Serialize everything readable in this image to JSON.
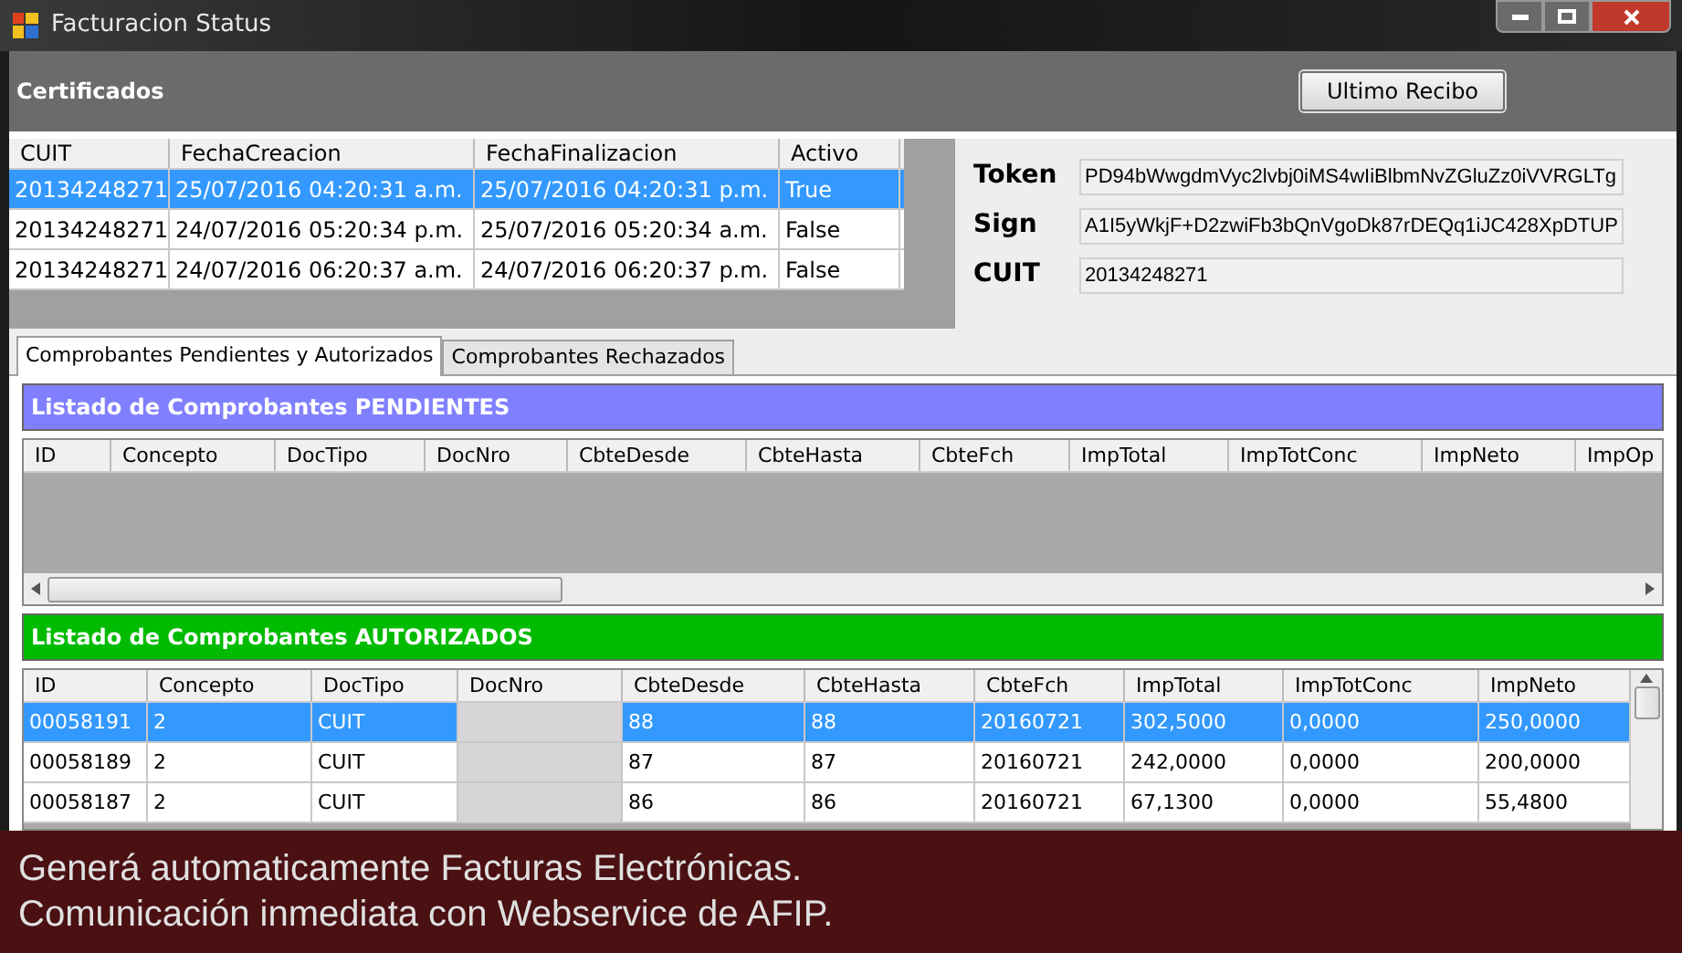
{
  "window": {
    "title": "Facturacion Status"
  },
  "certificados": {
    "title": "Certificados",
    "button": "Ultimo Recibo",
    "columns": [
      "CUIT",
      "FechaCreacion",
      "FechaFinalizacion",
      "Activo"
    ],
    "rows": [
      {
        "selected": true,
        "cells": [
          "20134248271",
          "25/07/2016 04:20:31 a.m.",
          "25/07/2016 04:20:31 p.m.",
          "True"
        ]
      },
      {
        "selected": false,
        "cells": [
          "20134248271",
          "24/07/2016 05:20:34 p.m.",
          "25/07/2016 05:20:34 a.m.",
          "False"
        ]
      },
      {
        "selected": false,
        "cells": [
          "20134248271",
          "24/07/2016 06:20:37 a.m.",
          "24/07/2016 06:20:37 p.m.",
          "False"
        ]
      }
    ]
  },
  "credentials": [
    {
      "label": "Token",
      "value": "PD94bWwgdmVyc2lvbj0iMS4wIiBlbmNvZGluZz0iVVRGLTg"
    },
    {
      "label": "Sign",
      "value": "A1I5yWkjF+D2zwiFb3bQnVgoDk87rDEQq1iJC428XpDTUP"
    },
    {
      "label": "CUIT",
      "value": "20134248271"
    }
  ],
  "tabs": [
    {
      "label": "Comprobantes Pendientes y Autorizados",
      "selected": true
    },
    {
      "label": "Comprobantes Rechazados",
      "selected": false
    }
  ],
  "pendientes": {
    "title": "Listado de Comprobantes PENDIENTES",
    "columns": [
      "ID",
      "Concepto",
      "DocTipo",
      "DocNro",
      "CbteDesde",
      "CbteHasta",
      "CbteFch",
      "ImpTotal",
      "ImpTotConc",
      "ImpNeto",
      "ImpOp"
    ]
  },
  "autorizados": {
    "title": "Listado de Comprobantes AUTORIZADOS",
    "columns": [
      "ID",
      "Concepto",
      "DocTipo",
      "DocNro",
      "CbteDesde",
      "CbteHasta",
      "CbteFch",
      "ImpTotal",
      "ImpTotConc",
      "ImpNeto"
    ],
    "rows": [
      {
        "selected": true,
        "cells": [
          {
            "kind": "text",
            "text": "00058191"
          },
          {
            "kind": "text",
            "text": "2"
          },
          {
            "kind": "text",
            "text": "CUIT"
          },
          {
            "kind": "blurred"
          },
          {
            "kind": "text",
            "text": "88"
          },
          {
            "kind": "text",
            "text": "88"
          },
          {
            "kind": "text",
            "text": "20160721"
          },
          {
            "kind": "text",
            "text": "302,5000"
          },
          {
            "kind": "text",
            "text": "0,0000"
          },
          {
            "kind": "text",
            "text": "250,0000"
          }
        ]
      },
      {
        "selected": false,
        "cells": [
          {
            "kind": "text",
            "text": "00058189"
          },
          {
            "kind": "text",
            "text": "2"
          },
          {
            "kind": "text",
            "text": "CUIT"
          },
          {
            "kind": "blurred"
          },
          {
            "kind": "text",
            "text": "87"
          },
          {
            "kind": "text",
            "text": "87"
          },
          {
            "kind": "text",
            "text": "20160721"
          },
          {
            "kind": "text",
            "text": "242,0000"
          },
          {
            "kind": "text",
            "text": "0,0000"
          },
          {
            "kind": "text",
            "text": "200,0000"
          }
        ]
      },
      {
        "selected": false,
        "cells": [
          {
            "kind": "text",
            "text": "00058187"
          },
          {
            "kind": "text",
            "text": "2"
          },
          {
            "kind": "text",
            "text": "CUIT"
          },
          {
            "kind": "blurred"
          },
          {
            "kind": "text",
            "text": "86"
          },
          {
            "kind": "text",
            "text": "86"
          },
          {
            "kind": "text",
            "text": "20160721"
          },
          {
            "kind": "text",
            "text": "67,1300"
          },
          {
            "kind": "text",
            "text": "0,0000"
          },
          {
            "kind": "text",
            "text": "55,4800"
          }
        ]
      }
    ]
  },
  "banner": {
    "lines": [
      "Generá automaticamente Facturas Electrónicas.",
      "Comunicación inmediata con Webservice de AFIP."
    ]
  }
}
